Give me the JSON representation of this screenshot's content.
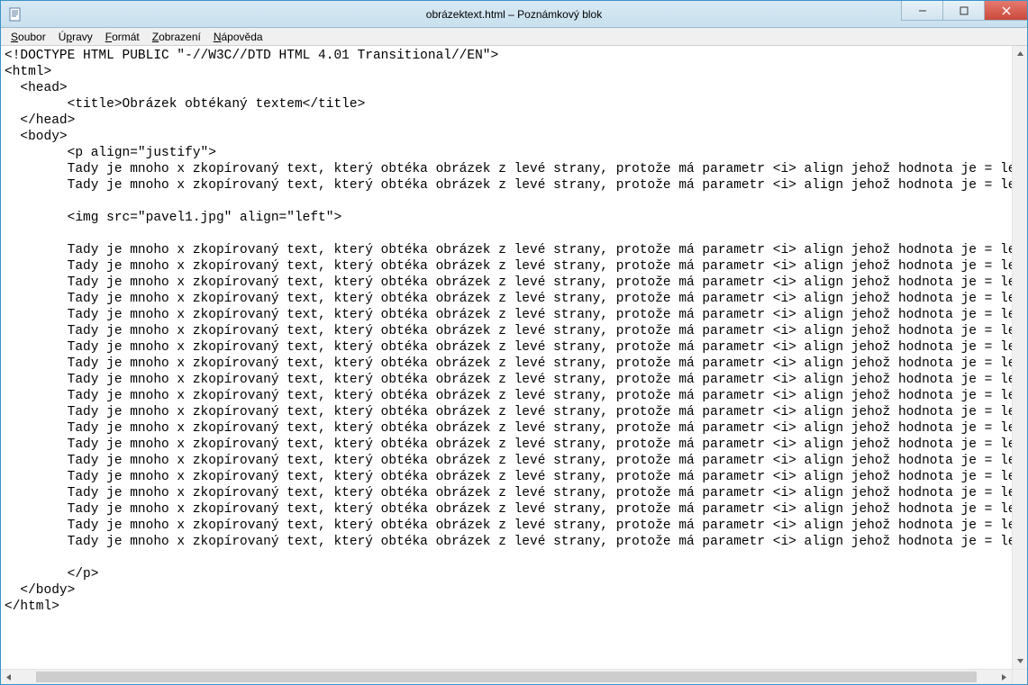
{
  "window": {
    "title": "obrázektext.html – Poznámkový blok"
  },
  "menu": {
    "items": [
      {
        "label": "Soubor",
        "uidx": 0
      },
      {
        "label": "Úpravy",
        "uidx": 1
      },
      {
        "label": "Formát",
        "uidx": 0
      },
      {
        "label": "Zobrazení",
        "uidx": 0
      },
      {
        "label": "Nápověda",
        "uidx": 0
      }
    ]
  },
  "document": {
    "doctype": "<!DOCTYPE HTML PUBLIC \"-//W3C//DTD HTML 4.01 Transitional//EN\">",
    "html_open": "<html>",
    "head_open": "  <head>",
    "title_line": "        <title>Obrázek obtékaný textem</title>",
    "head_close": "  </head>",
    "body_open": "  <body>",
    "p_open": "        <p align=\"justify\">",
    "repeat_line": "        Tady je mnoho x zkopírovaný text, který obtéka obrázek z levé strany, protože má parametr <i> align jehož hodnota je = left. </i>",
    "img_line": "        <img src=\"pavel1.jpg\" align=\"left\">",
    "p_close": "        </p>",
    "body_close": "  </body>",
    "html_close": "</html>",
    "pre_img_repeat_count": 2,
    "post_img_repeat_count": 19
  },
  "scroll": {
    "h_thumb_left_pct": 2,
    "h_thumb_width_pct": 96
  }
}
